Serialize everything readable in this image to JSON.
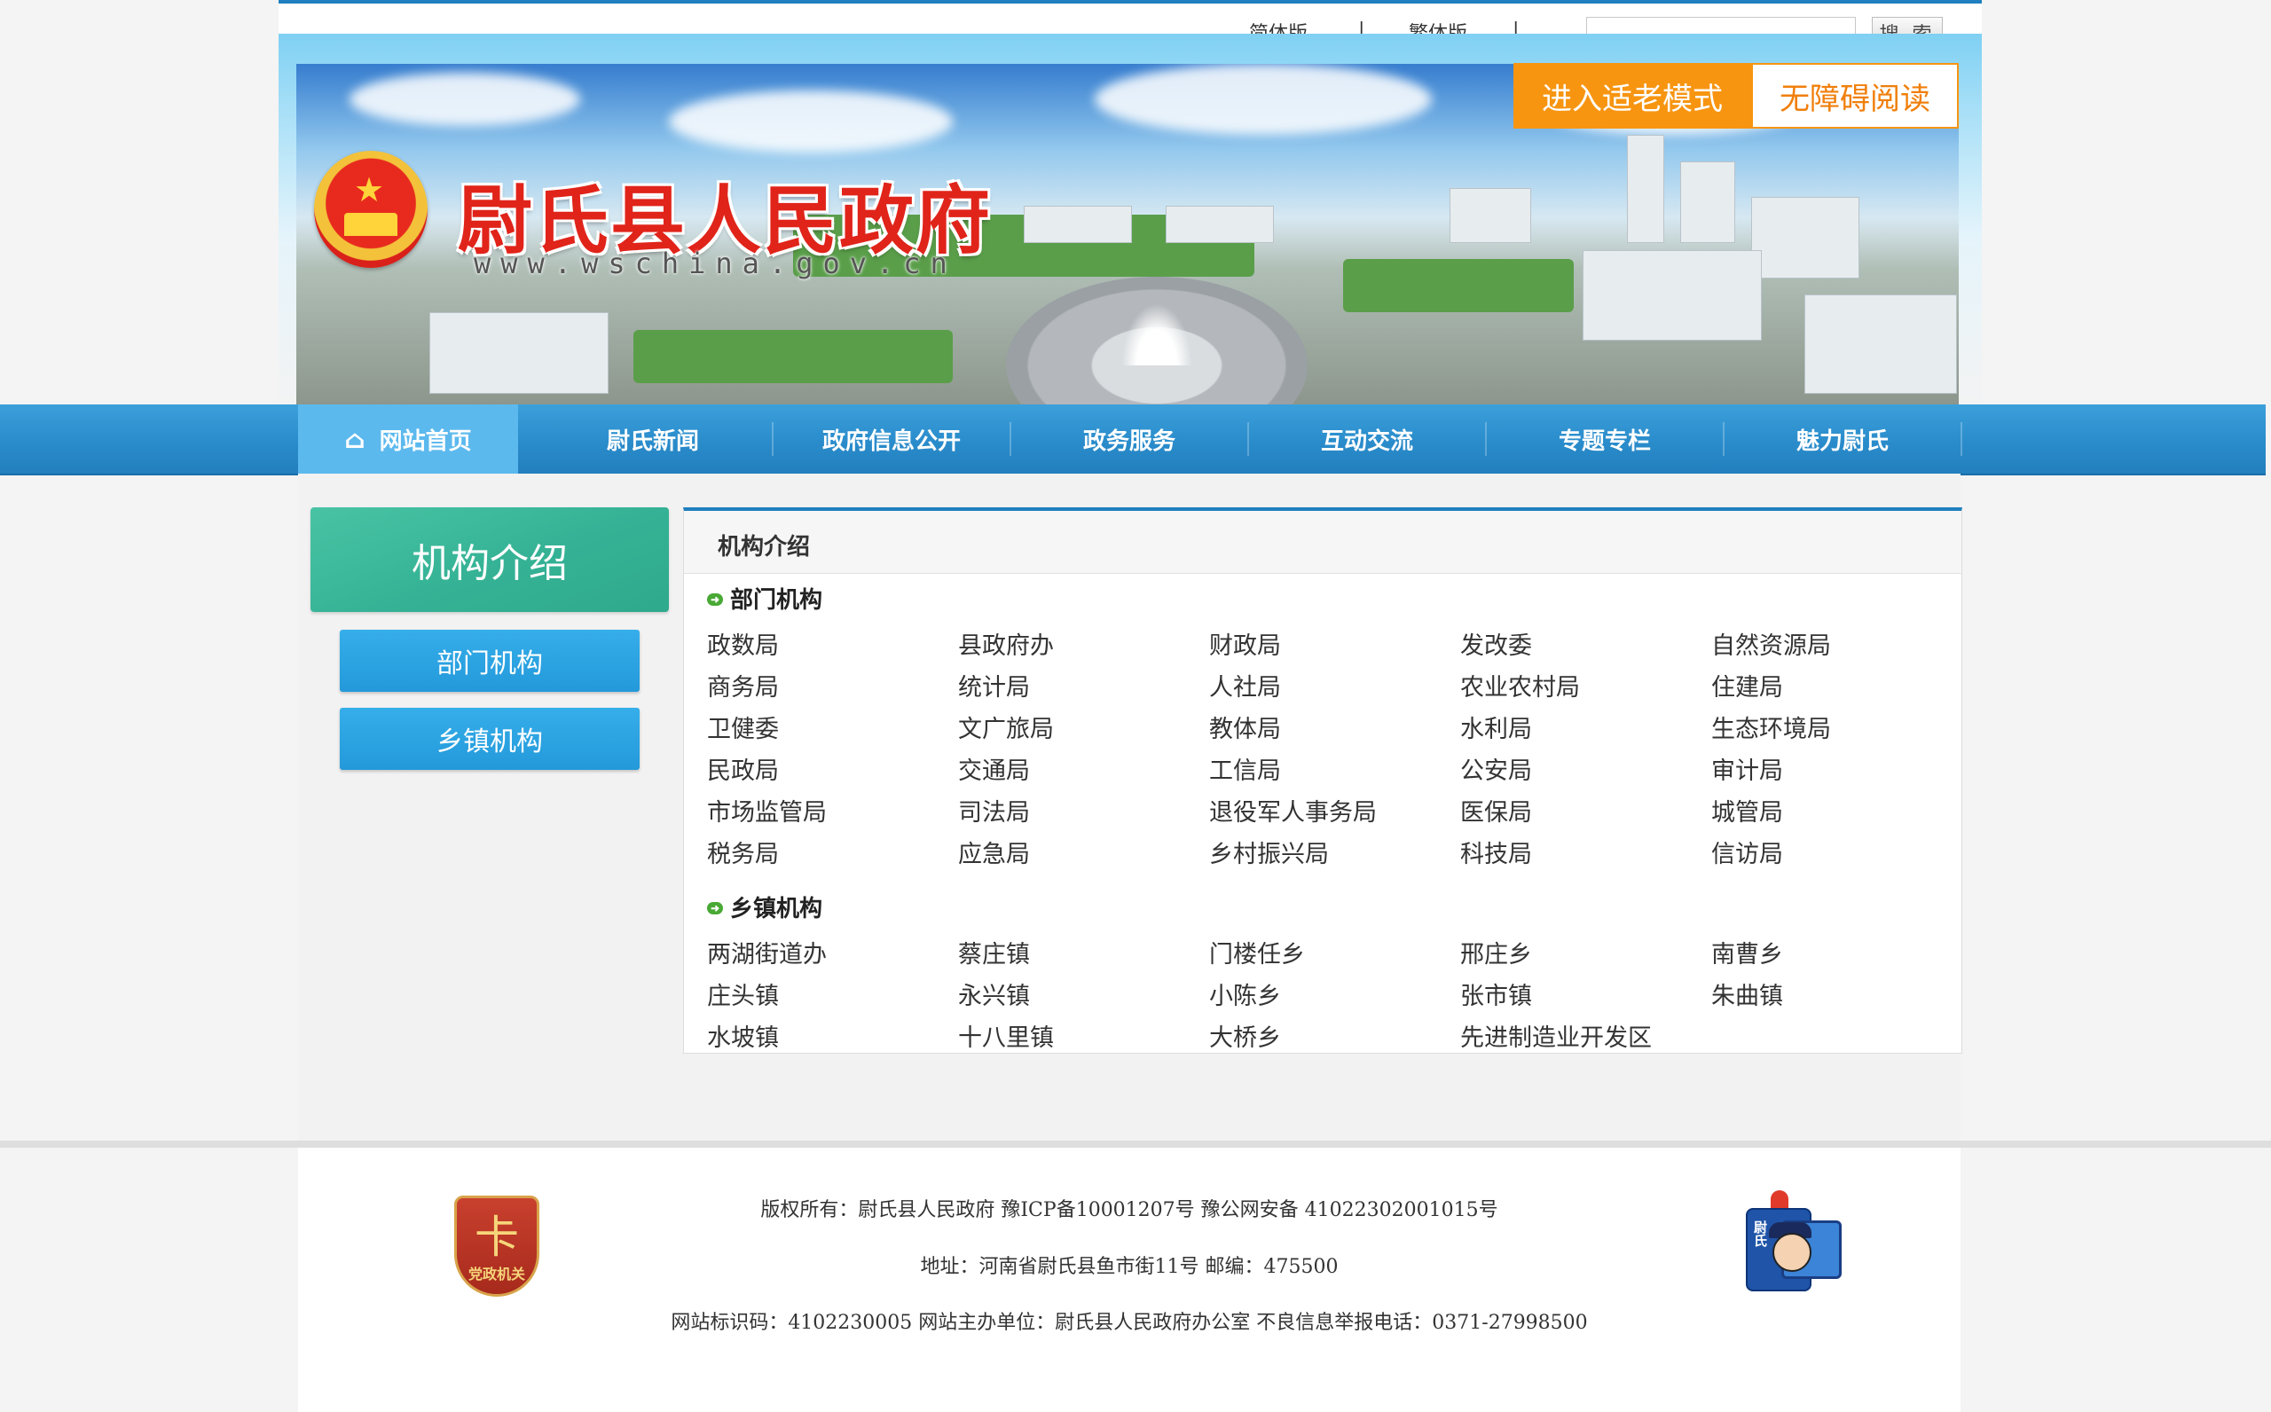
{
  "top": {
    "lang_simplified": "简体版",
    "separator": "|",
    "lang_traditional": "繁体版",
    "search_placeholder": "",
    "search_button": "搜 索"
  },
  "banner": {
    "site_title": "尉氏县人民政府",
    "site_domain": "www.wschina.gov.cn",
    "elder_mode": "进入适老模式",
    "barrier_free": "无障碍阅读"
  },
  "nav": {
    "items": [
      "网站首页",
      "尉氏新闻",
      "政府信息公开",
      "政务服务",
      "互动交流",
      "专题专栏",
      "魅力尉氏"
    ],
    "active_index": 0
  },
  "sidebar": {
    "title": "机构介绍",
    "buttons": [
      "部门机构",
      "乡镇机构"
    ]
  },
  "content": {
    "title": "机构介绍",
    "sections": [
      {
        "heading": "部门机构",
        "items": [
          "政数局",
          "县政府办",
          "财政局",
          "发改委",
          "自然资源局",
          "商务局",
          "统计局",
          "人社局",
          "农业农村局",
          "住建局",
          "卫健委",
          "文广旅局",
          "教体局",
          "水利局",
          "生态环境局",
          "民政局",
          "交通局",
          "工信局",
          "公安局",
          "审计局",
          "市场监管局",
          "司法局",
          "退役军人事务局",
          "医保局",
          "城管局",
          "税务局",
          "应急局",
          "乡村振兴局",
          "科技局",
          "信访局"
        ]
      },
      {
        "heading": "乡镇机构",
        "items": [
          "两湖街道办",
          "蔡庄镇",
          "门楼任乡",
          "邢庄乡",
          "南曹乡",
          "庄头镇",
          "永兴镇",
          "小陈乡",
          "张市镇",
          "朱曲镇",
          "水坡镇",
          "十八里镇",
          "大桥乡",
          "先进制造业开发区"
        ]
      }
    ]
  },
  "footer": {
    "line1": "版权所有：尉氏县人民政府 豫ICP备10001207号 豫公网安备 41022302001015号",
    "line2": "地址：河南省尉氏县鱼市街11号 邮编：475500",
    "line3": "网站标识码：4102230005 网站主办单位：尉氏县人民政府办公室 不良信息举报电话：0371-27998500",
    "party_badge_text": "党政机关",
    "police_label": "尉氏"
  },
  "icons": {
    "home": "home-icon",
    "section_bullet": "arrow-right-icon",
    "emblem": "national-emblem-icon",
    "party": "party-government-badge-icon",
    "police": "cyber-police-icon"
  },
  "colors": {
    "nav_bg": "#2a8ccb",
    "nav_active": "#5cb9ee",
    "accent_blue": "#1f7fbf",
    "orange": "#f79511",
    "sidebar_green": "#35b295",
    "sidebar_button": "#2a9fe0",
    "title_red": "#e0241a"
  }
}
